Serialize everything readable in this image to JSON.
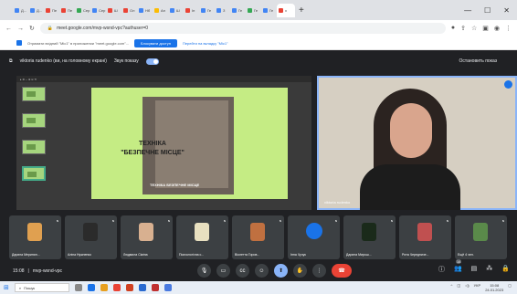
{
  "browser": {
    "tabs": [
      {
        "label": "Д...",
        "color": "#4285f4"
      },
      {
        "label": "Д...",
        "color": "#4285f4"
      },
      {
        "label": "Пе",
        "color": "#ea4335"
      },
      {
        "label": "Пе",
        "color": "#ea4335"
      },
      {
        "label": "Сер",
        "color": "#34a853"
      },
      {
        "label": "Сер",
        "color": "#4285f4"
      },
      {
        "label": "Ш",
        "color": "#ea4335"
      },
      {
        "label": "Ол",
        "color": "#ea4335"
      },
      {
        "label": "Нб",
        "color": "#4285f4"
      },
      {
        "label": "Ан",
        "color": "#fbbc04"
      },
      {
        "label": "Ш",
        "color": "#4285f4"
      },
      {
        "label": "Ін",
        "color": "#ea4335"
      },
      {
        "label": "Ге",
        "color": "#4285f4"
      },
      {
        "label": "З",
        "color": "#4285f4"
      },
      {
        "label": "Ге",
        "color": "#4285f4"
      },
      {
        "label": "Ге",
        "color": "#34a853"
      },
      {
        "label": "Ге",
        "color": "#4285f4"
      }
    ],
    "active_tab_label": "x",
    "new_tab": "+",
    "url": "meet.google.com/mvp-wsnd-vpc?authuser=0",
    "infobar": {
      "text": "Отримати вхідний \"Mic1\" в приложении \"meet.google.com\"...",
      "allow_button": "Блокувати доступ",
      "link": "Перейти на вкладку \"Mic1\""
    }
  },
  "meet": {
    "presenting_label": "viktoria rudenko (ви, на головному екрані)",
    "sound_label": "Звук показу",
    "stop_label": "Остановить показ",
    "slide": {
      "title_line1": "ТЕХНІКА",
      "title_line2": "\"БЕЗПЕЧНЕ МІСЦЕ\"",
      "caption": "ТЕХНІКА БЕЗПЕЧНЕ МІСЦЕ"
    },
    "speaker_name": "viktoria rudenko",
    "participants": [
      {
        "name": "Дарина Меринян...",
        "avatar": "#e0a050"
      },
      {
        "name": "Аліна Нужненко",
        "avatar": "#2b2b2b"
      },
      {
        "name": "Людмила Сіміна",
        "avatar": "#d8b090"
      },
      {
        "name": "Психологічна с...",
        "avatar": "#e8e0c0"
      },
      {
        "name": "Віолетта Горов...",
        "avatar": "#c07040"
      },
      {
        "name": "Інна Чучук",
        "avatar": "#1a73e8"
      },
      {
        "name": "Дарина Мирош...",
        "avatar": "#1a2a1a"
      },
      {
        "name": "Рита Чередниче...",
        "avatar": "#c05050"
      },
      {
        "name": "Ещё 4 чел.",
        "avatar": "#5a8a4a"
      }
    ],
    "time": "15:08",
    "meeting_code": "mvp-wsnd-vpc",
    "participant_count": "14"
  },
  "taskbar": {
    "search": "Пошук",
    "time": "15:08",
    "date": "24.01.2023",
    "lang": "УКР"
  }
}
